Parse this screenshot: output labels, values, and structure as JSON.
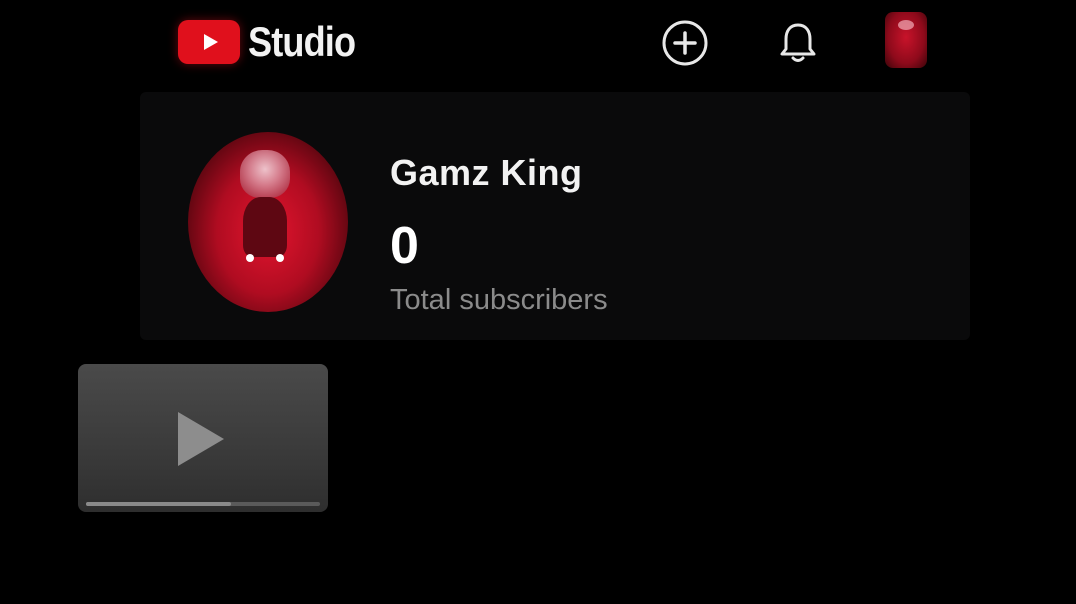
{
  "header": {
    "logo_text": "Studio",
    "icons": {
      "create": "create-icon",
      "notifications": "bell-icon",
      "account": "avatar"
    },
    "brand_color": "#e0101c"
  },
  "channel": {
    "name": "Gamz King",
    "subscriber_count": "0",
    "subscriber_label": "Total subscribers"
  },
  "video_placeholder": {
    "icon": "play-icon",
    "progress": 0.62
  }
}
